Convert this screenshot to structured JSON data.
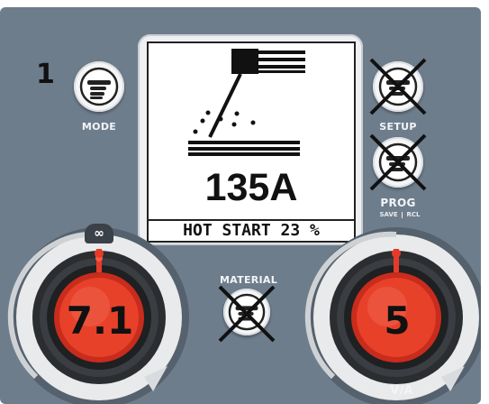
{
  "step_number": "1",
  "buttons": {
    "mode": {
      "label": "MODE",
      "disabled": false
    },
    "setup": {
      "label": "SETUP",
      "disabled": true
    },
    "prog": {
      "label": "PROG",
      "sub_left": "SAVE",
      "sub_right": "RCL",
      "disabled": true
    },
    "material": {
      "label": "MATERIAL",
      "disabled": true
    }
  },
  "display": {
    "current": "135A",
    "status": "HOT START 23 %"
  },
  "knob_left": {
    "value": "7.1"
  },
  "knob_right": {
    "value": "5",
    "label": "V/A"
  },
  "colors": {
    "panel": "#6e7d8c",
    "knob_red": "#e8412a",
    "indicator_red": "#e63b2a",
    "screen_bg": "#ffffff"
  }
}
